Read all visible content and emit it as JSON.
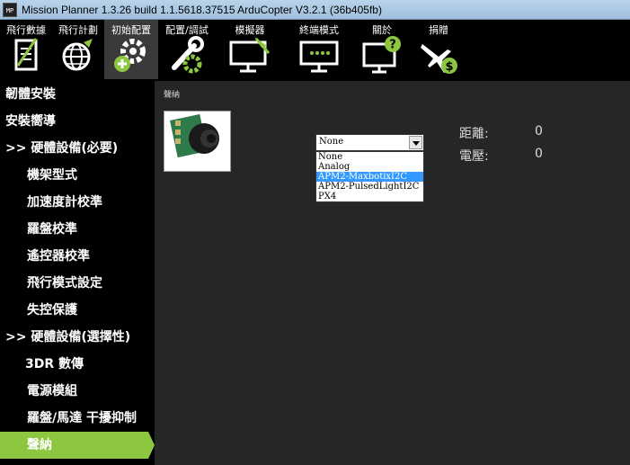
{
  "window": {
    "title": "Mission Planner 1.3.26 build 1.1.5618.37515 ArduCopter V3.2.1 (36b405fb)",
    "icon_text": "MP"
  },
  "menu": [
    {
      "label": "飛行數據",
      "icon": "flight-data-icon"
    },
    {
      "label": "飛行計劃",
      "icon": "flight-plan-icon"
    },
    {
      "label": "初始配置",
      "icon": "initial-setup-icon"
    },
    {
      "label": "配置/調試",
      "icon": "config-tuning-icon"
    },
    {
      "label": "模擬器",
      "icon": "simulation-icon"
    },
    {
      "label": "終端模式",
      "icon": "terminal-icon"
    },
    {
      "label": "關於",
      "icon": "help-icon"
    },
    {
      "label": "捐贈",
      "icon": "donate-icon"
    }
  ],
  "sidebar": [
    {
      "label": "韌體安裝"
    },
    {
      "label": "安裝嚮導"
    },
    {
      "label": ">> 硬體設備(必要)"
    },
    {
      "label": "機架型式"
    },
    {
      "label": "加速度計校準"
    },
    {
      "label": "羅盤校準"
    },
    {
      "label": "遙控器校準"
    },
    {
      "label": "飛行模式設定"
    },
    {
      "label": "失控保護"
    },
    {
      "label": ">> 硬體設備(選擇性)"
    },
    {
      "label": "3DR 數傳"
    },
    {
      "label": "電源模組"
    },
    {
      "label": "羅盤/馬達 干擾抑制"
    },
    {
      "label": "聲納"
    }
  ],
  "main": {
    "section_label": "聲納",
    "sonar_type": {
      "value": "None",
      "options": [
        "None",
        "Analog",
        "APM2-MaxbotixI2C",
        "APM2-PulsedLightI2C",
        "PX4"
      ],
      "highlighted": "APM2-MaxbotixI2C"
    },
    "distance": {
      "label": "距離:",
      "value": "0"
    },
    "voltage": {
      "label": "電壓:",
      "value": "0"
    }
  },
  "colors": {
    "accent": "#8dc63f",
    "menu_bg": "#000000",
    "panel_bg": "#262626",
    "highlight": "#3399ff"
  }
}
